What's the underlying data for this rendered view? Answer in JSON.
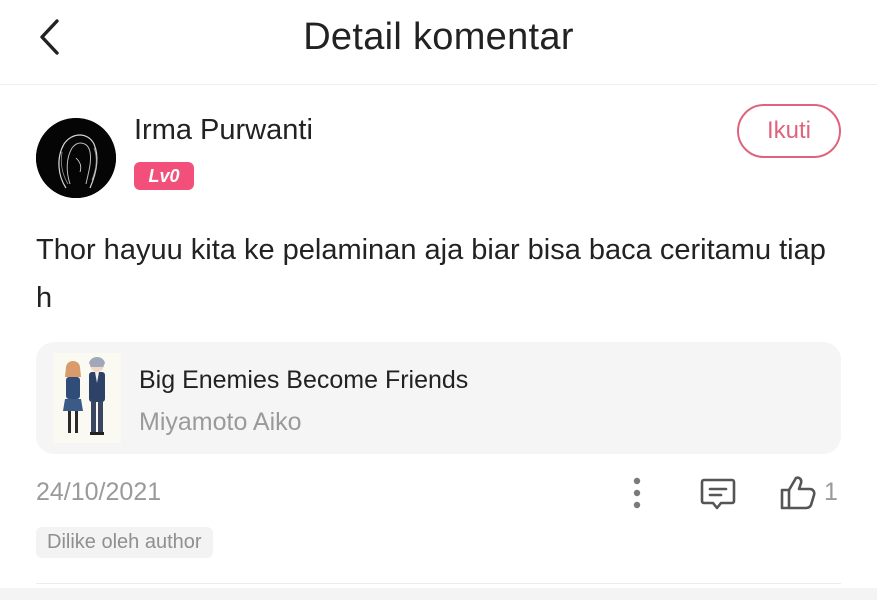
{
  "header": {
    "title": "Detail komentar",
    "back_icon": "chevron-left-icon"
  },
  "comment": {
    "user": {
      "name": "Irma Purwanti",
      "level": "Lv0",
      "avatar": "avatar-silhouette-image",
      "follow_label": "Ikuti"
    },
    "text": "Thor hayuu kita ke pelaminan aja biar bisa baca ceritamu tiap h",
    "book": {
      "title": "Big Enemies Become Friends",
      "author": "Miyamoto Aiko",
      "cover": "book-cover-image"
    },
    "date": "24/10/2021",
    "actions": {
      "more_icon": "more-vertical-icon",
      "reply_icon": "comment-icon",
      "like_icon": "thumbs-up-icon",
      "like_count": "1"
    },
    "liked_tag": "Dilike oleh author"
  },
  "colors": {
    "accent": "#e0637e",
    "badge": "#f2507a",
    "muted_text": "#9a9a9a",
    "card_bg": "#f5f5f5"
  }
}
